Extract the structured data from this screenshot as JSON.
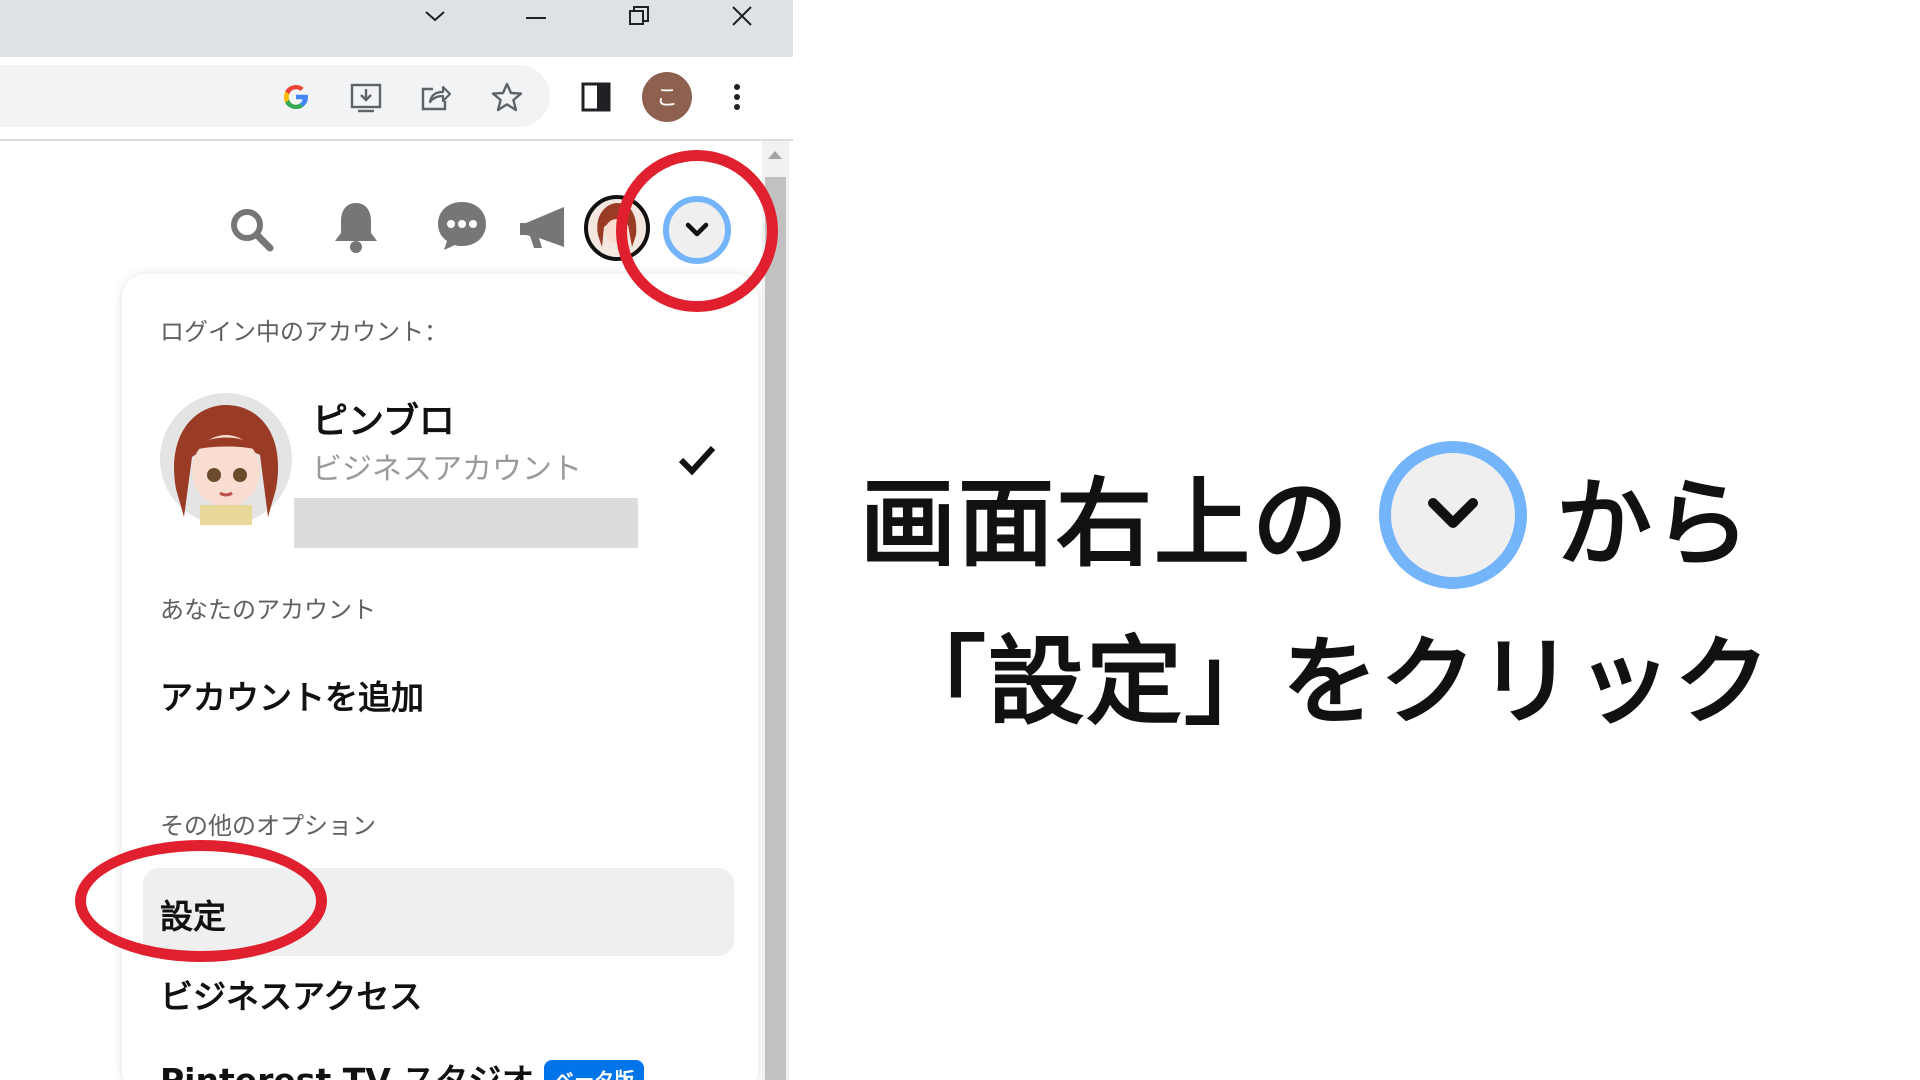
{
  "browser": {
    "window_controls": [
      "chevron-down",
      "minimize",
      "restore",
      "close"
    ],
    "toolbar_icons": [
      "google-icon",
      "install-icon",
      "share-icon",
      "bookmark-star-icon",
      "side-panel-icon",
      "profile-avatar",
      "more-icon"
    ],
    "profile_initial": "こ",
    "profile_color": "#8d6050"
  },
  "header_icons": [
    "search-icon",
    "bell-icon",
    "messages-icon",
    "megaphone-icon",
    "avatar",
    "account-dropdown-icon"
  ],
  "menu": {
    "logged_in_label": "ログイン中のアカウント：",
    "account": {
      "name": "ピンブロ",
      "type": "ビジネスアカウント"
    },
    "your_accounts_label": "あなたのアカウント",
    "add_account": "アカウントを追加",
    "other_options_label": "その他のオプション",
    "settings": "設定",
    "business_access": "ビジネスアクセス",
    "pinterest_tv": "Pinterest TV スタジオ",
    "beta_badge": "ベータ版"
  },
  "caption": {
    "line1_before": "画面右上の",
    "line1_after": "から",
    "line2": "「設定」をクリック"
  },
  "colors": {
    "highlight_red": "#e0202e",
    "dropdown_ring": "#74b4fb",
    "beta_blue": "#0074e8"
  }
}
